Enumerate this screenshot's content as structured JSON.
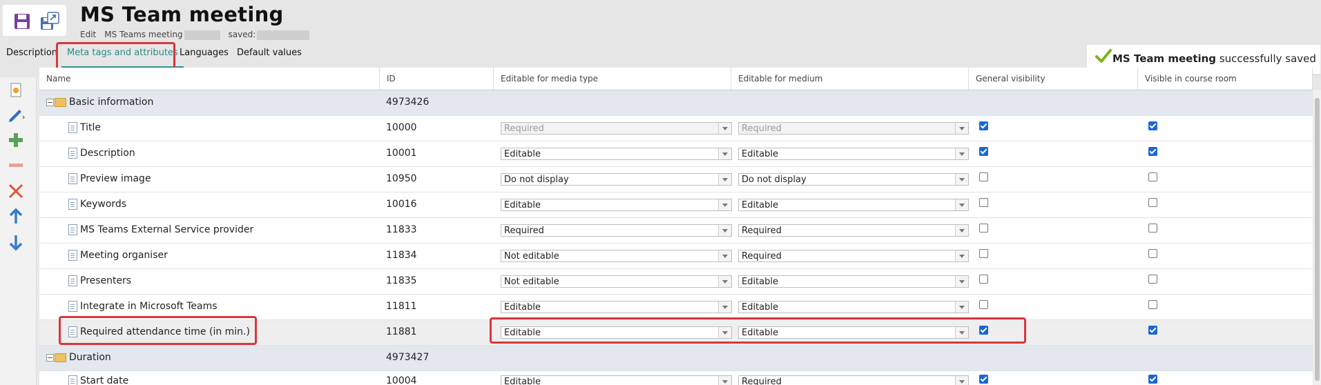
{
  "header": {
    "title": "MS Team meeting",
    "meta_edit": "Edit",
    "meta_name": "MS Teams meeting",
    "meta_saved": "saved:"
  },
  "toolbar_icons": [
    "save-icon",
    "save-as-icon"
  ],
  "tabs": [
    {
      "label": "Description",
      "active": false
    },
    {
      "label": "Meta tags and attributes",
      "active": true
    },
    {
      "label": "Languages",
      "active": false
    },
    {
      "label": "Default values",
      "active": false
    }
  ],
  "toast": {
    "bold": "MS Team meeting",
    "text": " successfully saved",
    "icon": "checkmark-icon",
    "color": "#7ab317"
  },
  "side_toolbar": [
    "new-icon",
    "edit-icon",
    "add-icon",
    "remove-icon",
    "delete-icon",
    "move-up-icon",
    "move-down-icon"
  ],
  "columns": [
    "Name",
    "ID",
    "Editable for media type",
    "Editable for medium",
    "General visibility",
    "Visible in course room"
  ],
  "rows": [
    {
      "type": "group",
      "name": "Basic information",
      "id": "4973426"
    },
    {
      "type": "item",
      "name": "Title",
      "id": "10000",
      "media_type": "Required",
      "medium": "Required",
      "disabled": true,
      "general": true,
      "course": true
    },
    {
      "type": "item",
      "name": "Description",
      "id": "10001",
      "media_type": "Editable",
      "medium": "Editable",
      "disabled": false,
      "general": true,
      "course": true
    },
    {
      "type": "item",
      "name": "Preview image",
      "id": "10950",
      "media_type": "Do not display",
      "medium": "Do not display",
      "disabled": false,
      "general": false,
      "course": false
    },
    {
      "type": "item",
      "name": "Keywords",
      "id": "10016",
      "media_type": "Editable",
      "medium": "Editable",
      "disabled": false,
      "general": false,
      "course": false
    },
    {
      "type": "item",
      "name": "MS Teams External Service provider",
      "id": "11833",
      "media_type": "Required",
      "medium": "Required",
      "disabled": false,
      "general": false,
      "course": false
    },
    {
      "type": "item",
      "name": "Meeting organiser",
      "id": "11834",
      "media_type": "Not editable",
      "medium": "Required",
      "disabled": false,
      "general": false,
      "course": false
    },
    {
      "type": "item",
      "name": "Presenters",
      "id": "11835",
      "media_type": "Not editable",
      "medium": "Editable",
      "disabled": false,
      "general": false,
      "course": false
    },
    {
      "type": "item",
      "name": "Integrate in Microsoft Teams",
      "id": "11811",
      "media_type": "Editable",
      "medium": "Editable",
      "disabled": false,
      "general": false,
      "course": false
    },
    {
      "type": "item",
      "name": "Required attendance time (in min.)",
      "id": "11881",
      "media_type": "Editable",
      "medium": "Editable",
      "disabled": false,
      "general": true,
      "course": true,
      "selected": true
    },
    {
      "type": "group",
      "name": "Duration",
      "id": "4973427"
    },
    {
      "type": "item",
      "name": "Start date",
      "id": "10004",
      "media_type": "Editable",
      "medium": "Required",
      "disabled": false,
      "general": true,
      "course": true
    }
  ],
  "colors": {
    "accent": "#2a8a8a",
    "highlight": "#d9363e",
    "checkbox": "#1a66d6"
  }
}
